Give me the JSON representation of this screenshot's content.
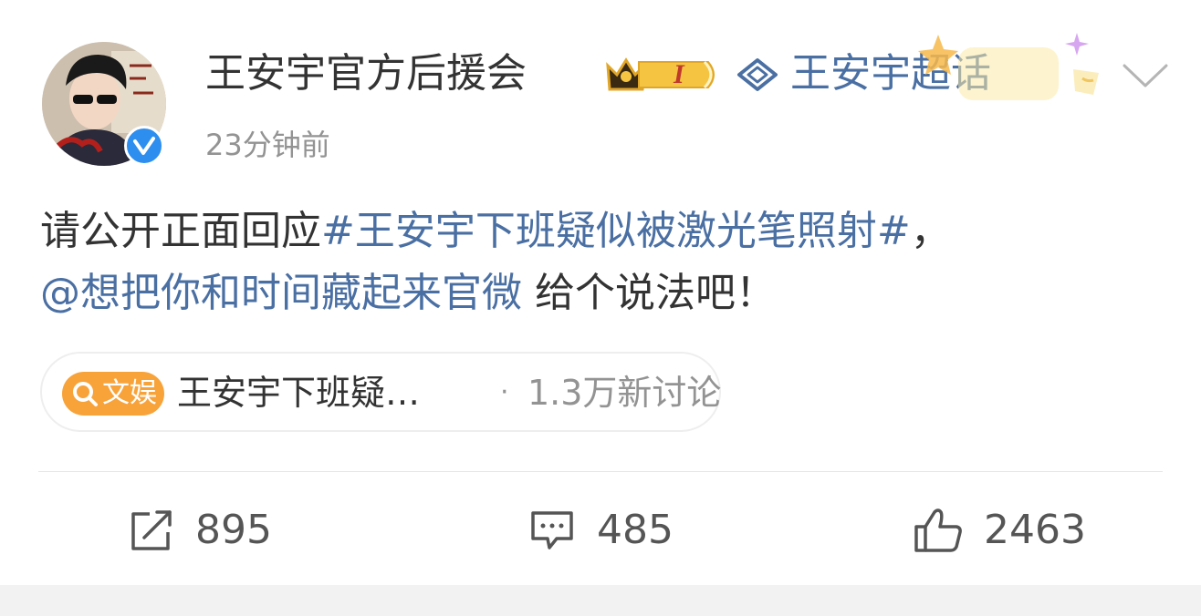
{
  "post": {
    "author": {
      "name": "王安宇官方后援会",
      "level_badge": "I",
      "avatar_icon": "avatar-image",
      "verified_icon": "verified-check-icon"
    },
    "supertopic": {
      "label": "王安宇超话",
      "icon": "gem-icon"
    },
    "timestamp": "23分钟前",
    "body": {
      "text_before": "请公开正面回应",
      "hashtag": "#王安宇下班疑似被激光笔照射#",
      "text_middle": "，",
      "mention": "@想把你和时间藏起来官微",
      "text_after": " 给个说法吧！"
    },
    "topic_card": {
      "badge": "文娱",
      "title": "王安宇下班疑…",
      "separator": "·",
      "discussion_count": "1.3万新讨论"
    },
    "actions": {
      "repost_count": "895",
      "comment_count": "485",
      "like_count": "2463"
    }
  },
  "colors": {
    "link": "#4a6fa3",
    "badge_orange": "#f8a33a",
    "verified_blue": "#2d8ef0",
    "muted": "#939393"
  }
}
